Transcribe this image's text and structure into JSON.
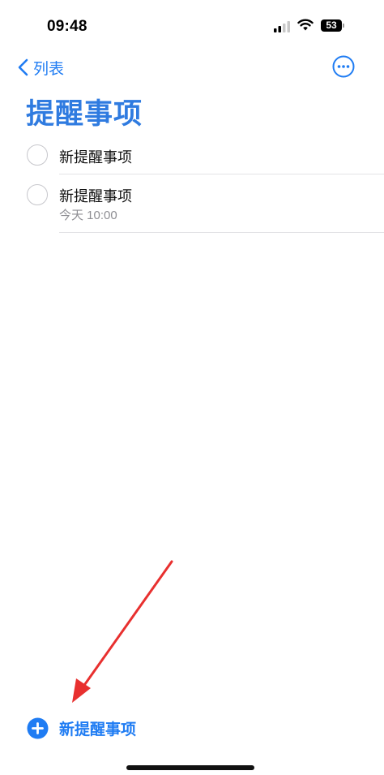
{
  "status_bar": {
    "time": "09:48",
    "battery": "53"
  },
  "nav": {
    "back_label": "列表",
    "back_icon": "chevron-left-icon",
    "more_icon": "ellipsis-circle-icon"
  },
  "page": {
    "title": "提醒事项"
  },
  "reminders": [
    {
      "title": "新提醒事项",
      "subtitle": ""
    },
    {
      "title": "新提醒事项",
      "subtitle": "今天 10:00"
    }
  ],
  "footer": {
    "add_label": "新提醒事项",
    "add_icon": "plus-circle-icon"
  },
  "colors": {
    "accent": "#1f7cf3",
    "title": "#2f7be0",
    "annotation_arrow": "#e8302f"
  }
}
